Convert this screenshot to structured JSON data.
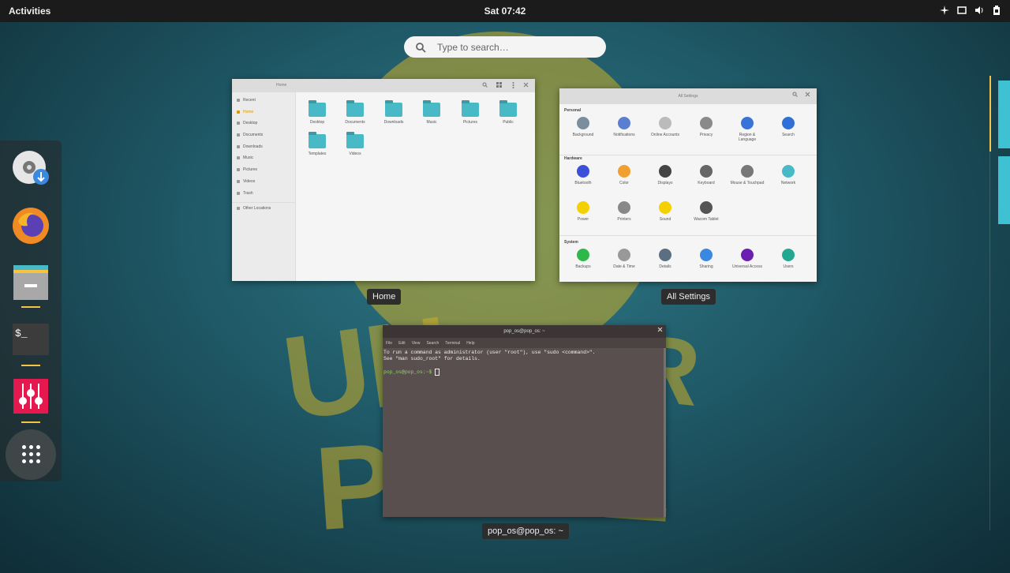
{
  "topbar": {
    "activities": "Activities",
    "clock": "Sat 07:42"
  },
  "search": {
    "placeholder": "Type to search…"
  },
  "dock": {
    "items": [
      "Pop!_Shop",
      "Firefox",
      "Files",
      "Terminal",
      "Settings"
    ],
    "apps_button": "Show Applications"
  },
  "files_window": {
    "title": "Home",
    "label": "Home",
    "sidebar": [
      "Recent",
      "Home",
      "Desktop",
      "Documents",
      "Downloads",
      "Music",
      "Pictures",
      "Videos",
      "Trash",
      "Other Locations"
    ],
    "folders": [
      "Desktop",
      "Documents",
      "Downloads",
      "Music",
      "Pictures",
      "Public",
      "Templates",
      "Videos"
    ]
  },
  "settings_window": {
    "title": "All Settings",
    "label": "All Settings",
    "sections": [
      {
        "name": "Personal",
        "items": [
          "Background",
          "Notifications",
          "Online Accounts",
          "Privacy",
          "Region & Language",
          "Search"
        ]
      },
      {
        "name": "Hardware",
        "items": [
          "Bluetooth",
          "Color",
          "Displays",
          "Keyboard",
          "Mouse & Touchpad",
          "Network",
          "Power",
          "Printers",
          "Sound",
          "Wacom Tablet"
        ]
      },
      {
        "name": "System",
        "items": [
          "Backups",
          "Date & Time",
          "Details",
          "Sharing",
          "Universal Access",
          "Users"
        ]
      }
    ],
    "icon_colors": {
      "Background": "#7a8ea0",
      "Notifications": "#5a7fd0",
      "Online Accounts": "#bbbbbb",
      "Privacy": "#8a8a8a",
      "Region & Language": "#3a73d8",
      "Search": "#2f6fd6",
      "Bluetooth": "#3b4fd8",
      "Color": "#f0a030",
      "Displays": "#444444",
      "Keyboard": "#666666",
      "Mouse & Touchpad": "#777777",
      "Network": "#48b9c7",
      "Power": "#f5d000",
      "Printers": "#888888",
      "Sound": "#f5d000",
      "Wacom Tablet": "#555555",
      "Backups": "#2fb84a",
      "Date & Time": "#999999",
      "Details": "#5a6f82",
      "Sharing": "#3a88e0",
      "Universal Access": "#6a1fb0",
      "Users": "#22a890"
    }
  },
  "terminal_window": {
    "title": "pop_os@pop_os: ~",
    "label": "pop_os@pop_os: ~",
    "menu": [
      "File",
      "Edit",
      "View",
      "Search",
      "Terminal",
      "Help"
    ],
    "line1": "To run a command as administrator (user \"root\"), use \"sudo <command>\".",
    "line2": "See \"man sudo_root\" for details.",
    "prompt": "pop_os@pop_os:~$ "
  }
}
